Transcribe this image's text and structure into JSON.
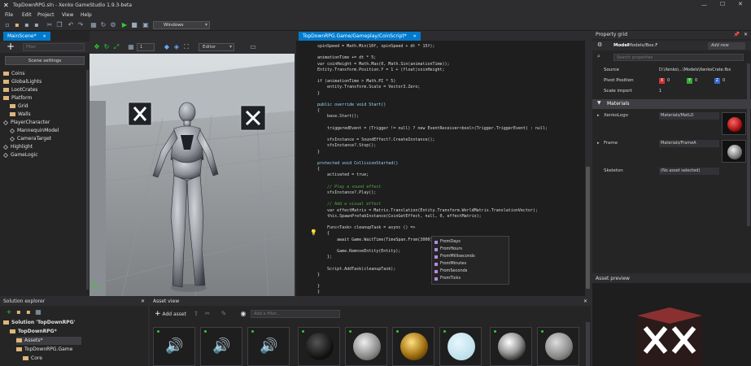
{
  "window": {
    "title": "TopDownRPG.sln - Xenko GameStudio 1.9.3-beta",
    "min": "—",
    "max": "☐",
    "close": "✕"
  },
  "menu": [
    "File",
    "Edit",
    "Project",
    "View",
    "Help"
  ],
  "toolbar": {
    "platform": "Windows"
  },
  "scene_tab": {
    "label": "MainScene*",
    "close": "✕"
  },
  "scene_toolbar": {
    "filter_placeholder": "Filter",
    "settings": "Scene settings",
    "grid_value": "1",
    "editor_mode": "Editor"
  },
  "scene_tree": [
    {
      "label": "Coins",
      "kind": "folder",
      "indent": 0
    },
    {
      "label": "GlobalLights",
      "kind": "folder",
      "indent": 0
    },
    {
      "label": "LootCrates",
      "kind": "folder",
      "indent": 0
    },
    {
      "label": "Platform",
      "kind": "folder",
      "indent": 0
    },
    {
      "label": "Grid",
      "kind": "folder",
      "indent": 1
    },
    {
      "label": "Walls",
      "kind": "folder",
      "indent": 1
    },
    {
      "label": "PlayerCharacter",
      "kind": "entity",
      "indent": 0
    },
    {
      "label": "MannequinModel",
      "kind": "entity",
      "indent": 1
    },
    {
      "label": "CameraTarget",
      "kind": "entity",
      "indent": 1
    },
    {
      "label": "Highlight",
      "kind": "entity",
      "indent": 0
    },
    {
      "label": "GameLogic",
      "kind": "entity",
      "indent": 0
    }
  ],
  "code_tab": {
    "label": "TopDownRPG.Game/Gameplay/CoinScript*",
    "close": "✕"
  },
  "code": [
    "spinSpeed = Math.Min(10f, spinSpeed + dt * 15f);",
    "",
    "animationTime += dt * 5;",
    "var coinHeight = Math.Max(0, Math.Sin(animationTime));",
    "Entity.Transform.Position.Y = 1 + (float)coinHeight;",
    "",
    "if (animationTime > Math.PI * 5)",
    "    entity.Transform.Scale = Vector3.Zero;",
    "}",
    "",
    "public override void Start()",
    "{",
    "    base.Start();",
    "",
    "    triggeredEvent = (Trigger != null) ? new EventReceiver<bool>(Trigger.TriggerEvent) : null;",
    "",
    "    sfxInstance = SoundEffect?.CreateInstance();",
    "    sfxInstance?.Stop();",
    "}",
    "",
    "protected void CollisionStarted()",
    "{",
    "    activated = true;",
    "",
    "    // Play a sound effect",
    "    sfxInstance?.Play();",
    "",
    "    // Add a visual effect",
    "    var effectMatrix = Matrix.Translation(Entity.Transform.WorldMatrix.TranslationVector);",
    "    this.SpawnPrefabInstance(CoinGetEffect, null, 0, effectMatrix);",
    "",
    "    Func<Task> cleanupTask = async () =>",
    "    {",
    "        await Game.WaitTime(TimeSpan.From(3000));",
    "",
    "        Game.RemoveEntity(Entity);",
    "    };",
    "",
    "    Script.AddTask(cleanupTask);",
    "}",
    "",
    "}",
    "}"
  ],
  "autocomplete": [
    "FromDays",
    "FromHours",
    "FromMilliseconds",
    "FromMinutes",
    "FromSeconds",
    "FromTicks"
  ],
  "property_grid": {
    "title": "Property grid",
    "model_label": "Model",
    "model_path": "Models/Box.F",
    "add_new": "Add new",
    "search_placeholder": "Search properties",
    "source_label": "Source",
    "source_value": "D:\\Xenko\\...\\Models\\XenkoCrate.fbx",
    "pivot_label": "Pivot Position",
    "pivot": {
      "x": "0",
      "y": "0",
      "z": "0"
    },
    "scale_label": "Scale import",
    "scale_value": "1",
    "materials_header": "Materials",
    "mat1_label": "XenkoLogo",
    "mat1_value": "Materials/MatLO",
    "mat2_label": "Frame",
    "mat2_value": "Materials/FrameA",
    "skeleton_label": "Skeleton",
    "skeleton_value": "(No asset selected)"
  },
  "solution_explorer": {
    "title": "Solution explorer",
    "rows": [
      {
        "label": "Solution 'TopDownRPG'",
        "indent": 0
      },
      {
        "label": "TopDownRPG*",
        "indent": 1
      },
      {
        "label": "Assets*",
        "indent": 2
      },
      {
        "label": "TopDownRPG.Game",
        "indent": 2
      },
      {
        "label": "Core",
        "indent": 3
      }
    ]
  },
  "asset_view": {
    "title": "Asset view",
    "add_asset": "Add asset",
    "filter_placeholder": "Add a filter..."
  },
  "asset_preview": {
    "title": "Asset preview"
  },
  "colors": {
    "accent": "#007acc",
    "bg": "#2d2d30",
    "code_bg": "#1e1e1e",
    "materials_header": "#3e3e42"
  }
}
